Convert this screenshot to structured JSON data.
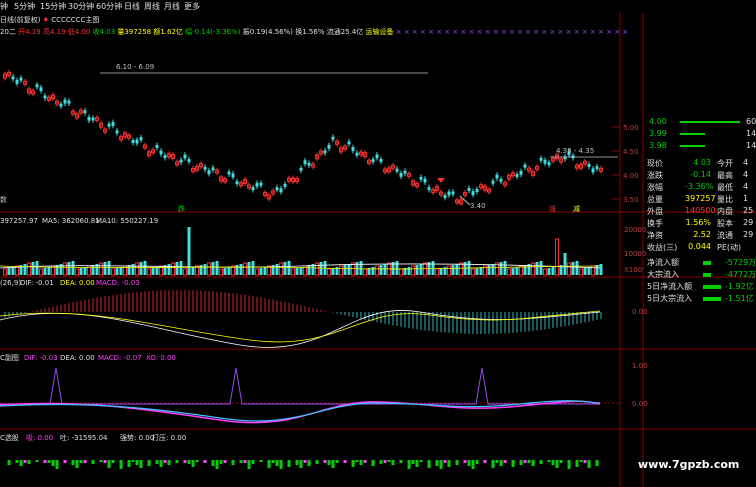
{
  "toolbar": [
    "钟",
    "5分钟",
    "15分钟",
    "30分钟",
    "60分钟",
    "日线",
    "周线",
    "月线",
    "更多"
  ],
  "main": {
    "title": "日线(前复权)",
    "stock_marker": "CCCCCCC主图",
    "infoline": [
      "20二",
      "开4.19",
      "高4.19",
      "低4.00",
      "收4.03",
      "量397258",
      "额1.62亿",
      "幅-0.14(-3.36%)",
      "振0.19(4.56%)",
      "换1.56%",
      "流通25.4亿",
      "运输设备"
    ],
    "annotations": {
      "hi1": "6.10 - 6.09",
      "hi2": "4.38 - 4.35",
      "low": "3.40",
      "die": "跌",
      "zhang": "涨",
      "xiao": "涨",
      "tui": "减",
      "yao": "数"
    },
    "yaxis": [
      "5.00",
      "4.50",
      "4.00",
      "3.50"
    ]
  },
  "right_top": {
    "prices": [
      "4.00",
      "3.99",
      "3.98"
    ],
    "vols": [
      "60",
      "14",
      "14"
    ],
    "bar_colors": [
      "#00d000",
      "#00d000",
      "#00d000"
    ]
  },
  "quote": [
    {
      "k": "现价",
      "v": "4.03",
      "vc": "#00d000",
      "k2": "今开",
      "v2": "4"
    },
    {
      "k": "涨跌",
      "v": "-0.14",
      "vc": "#00d000",
      "k2": "最高",
      "v2": "4"
    },
    {
      "k": "涨幅",
      "v": "-3.36%",
      "vc": "#00d000",
      "k2": "最低",
      "v2": "4"
    },
    {
      "k": "总量",
      "v": "397257",
      "vc": "#ffff00",
      "k2": "量比",
      "v2": "1"
    },
    {
      "k": "外盘",
      "v": "140500",
      "vc": "#ff3030",
      "k2": "内盘",
      "v2": "25"
    },
    {
      "k": "换手",
      "v": "1.56%",
      "vc": "#ffff00",
      "k2": "股本",
      "v2": "29"
    },
    {
      "k": "净资",
      "v": "2.52",
      "vc": "#ffff00",
      "k2": "流通",
      "v2": "29"
    },
    {
      "k": "收益(三)",
      "v": "0.044",
      "vc": "#ffff00",
      "k2": "PE(动)",
      "v2": ""
    }
  ],
  "flows": [
    {
      "label": "净流入额",
      "value": "-5729万",
      "color": "#00d000"
    },
    {
      "label": "大宗流入",
      "value": "-4772万",
      "color": "#00d000"
    },
    {
      "label": "5日净流入额",
      "value": "-1.92亿",
      "color": "#00d000"
    },
    {
      "label": "5日大宗流入",
      "value": "-1.51亿",
      "color": "#00d000"
    }
  ],
  "vol_panel": {
    "label": "397257.97",
    "ma5": "MA5: 362060.81",
    "ma10": "MA10: 550227.19",
    "yaxis": [
      "20000",
      "10000",
      "X100"
    ]
  },
  "macd_panel": {
    "label": "(26,9)",
    "dif": "DIF: -0.01",
    "dea": "DEA: 0.00",
    "macd": "MACD: -0.03",
    "yaxis": [
      "0.00"
    ]
  },
  "c_panel": {
    "label": "C副图",
    "dif": "DIF: -0.03",
    "dea": "DEA: 0.00",
    "macd": "MACD: -0.07",
    "xo": "XO: 0.00",
    "yaxis": [
      "1.00",
      "0.00"
    ]
  },
  "c2_panel": {
    "label": "C选股",
    "a": "吸: 0.00",
    "b": "吐: -31595.04",
    "c": "强势: 0.00",
    "d": "打压: 0.00"
  },
  "watermark": "www.7gpzb.com"
}
